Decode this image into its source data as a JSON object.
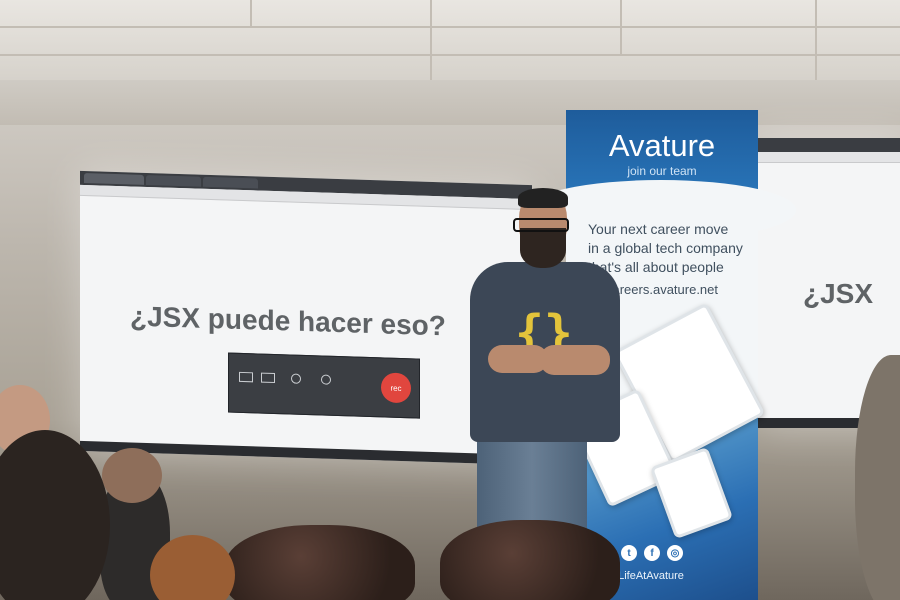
{
  "slide": {
    "title": "¿JSX puede hacer eso?",
    "title_right": "¿JSX",
    "record_button": "rec"
  },
  "banner": {
    "logo": "Avature",
    "tagline": "join our team",
    "text_line1": "Your next career move",
    "text_line2": "in a global tech company",
    "text_line3": "that's all about people",
    "url": "careers.avature.net",
    "social_icons": [
      "twitter-icon",
      "facebook-icon",
      "instagram-icon"
    ],
    "handle": "LifeAtAvature"
  },
  "shirt_print": "{}",
  "colors": {
    "banner_blue": "#2a78bd",
    "shirt": "#3c4756",
    "braces": "#e3c43b",
    "rec": "#e1463e"
  }
}
